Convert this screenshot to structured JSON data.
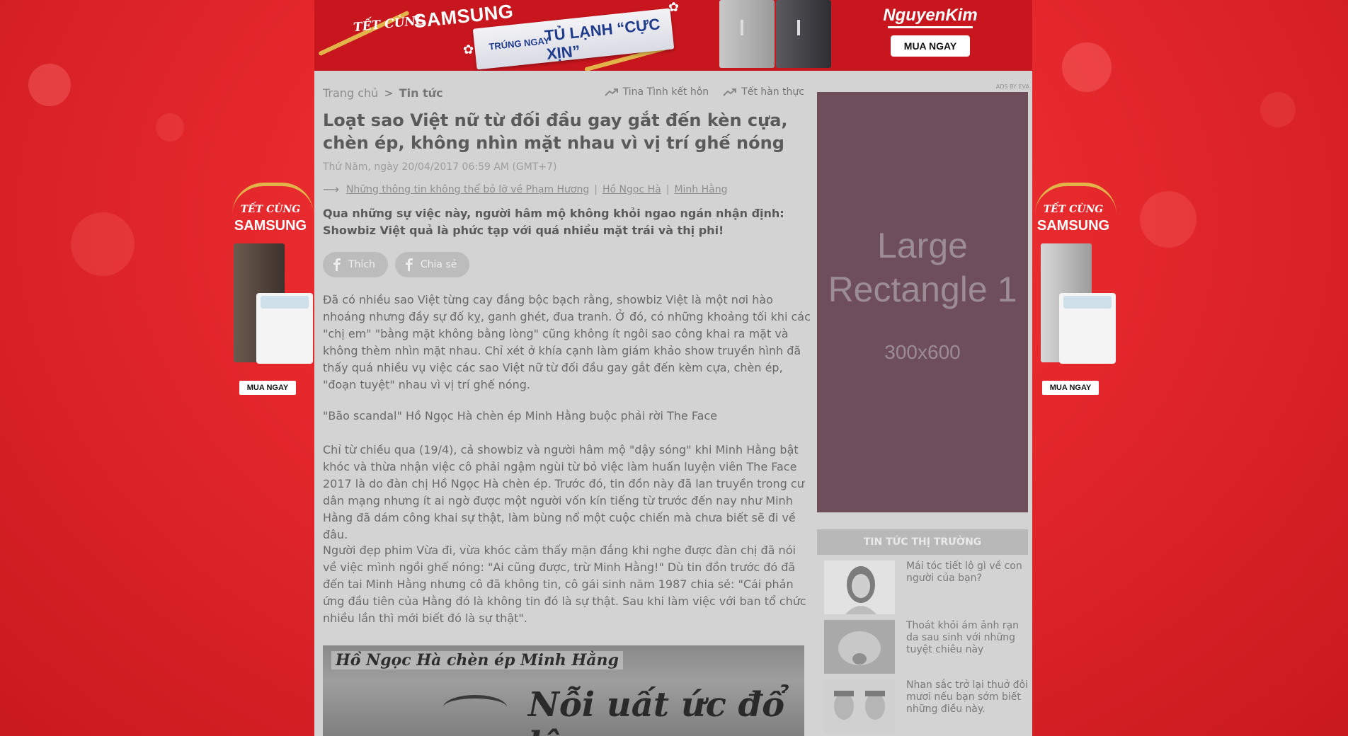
{
  "top_banner": {
    "tet": "TẾT CÙNG",
    "samsung": "SAMSUNG",
    "strip_small": "TRÚNG NGAY",
    "strip_big": "TỦ LẠNH “CỰC XỊN”",
    "brand": "NguyenKim",
    "cta": "MUA NGAY"
  },
  "side_left": {
    "tet": "TẾT CÙNG",
    "samsung": "SAMSUNG",
    "cta": "MUA NGAY"
  },
  "side_right": {
    "tet": "TẾT CÙNG",
    "samsung": "SAMSUNG",
    "cta": "MUA NGAY"
  },
  "breadcrumb": {
    "home": "Trang chủ",
    "sep": ">",
    "current": "Tin tức"
  },
  "tags": [
    {
      "label": "Tina Tình kết hôn",
      "icon": "trend-icon"
    },
    {
      "label": "Tết hàn thực",
      "icon": "trend-icon"
    }
  ],
  "article": {
    "title": "Loạt sao Việt nữ từ đối đầu gay gắt đến kèn cựa, chèn ép, không nhìn mặt nhau vì vị trí ghế nóng",
    "date": "Thứ Năm, ngày 20/04/2017 06:59 AM (GMT+7)",
    "related": [
      "Những thông tin không thể bỏ lỡ về Phạm Hương",
      "Hồ Ngọc Hà",
      "Minh Hằng"
    ],
    "related_sep": "|",
    "lead": "Qua những sự việc này, người hâm mộ không khỏi ngao ngán nhận định: Showbiz Việt quả là phức tạp với quá nhiều mặt trái và thị phi!",
    "like_label": "Thích",
    "share_label": "Chia sẻ",
    "paragraphs": [
      "Đã có nhiều sao Việt từng cay đắng bộc bạch rằng, showbiz Việt là một nơi hào nhoáng nhưng đầy sự đố kỵ, ganh ghét, đua tranh. Ở đó, có những khoảng tối khi các \"chị em\" \"bằng mặt không bằng lòng\" cũng không ít ngôi sao công khai ra mặt và không thèm nhìn mặt nhau. Chỉ xét ở khía cạnh làm giám khảo show truyền hình đã thấy quá nhiều vụ việc các sao Việt nữ từ đối đầu gay gắt đến kèm cựa, chèn ép, \"đoạn tuyệt\" nhau vì vị trí ghế nóng.",
      "\"Bão scandal\" Hồ Ngọc Hà chèn ép Minh Hằng buộc phải rời The Face",
      "Chỉ từ chiều qua (19/4), cả showbiz và người hâm mộ \"dậy sóng\" khi Minh Hằng bật khóc và thừa nhận việc cô phải ngậm ngùi từ bỏ việc làm huấn luyện viên The Face 2017 là do đàn chị Hồ Ngọc Hà chèn ép. Trước đó, tin đồn này đã lan truyền trong cư dân mạng nhưng ít ai ngờ được một người vốn kín tiếng từ trước đến nay như Minh Hằng đã dám công khai sự thật, làm bùng nổ một cuộc chiến mà chưa biết sẽ đi về đâu.",
      "Người đẹp phim Vừa đi, vừa khóc cảm thấy mặn đắng khi nghe được đàn chị đã nói về việc mình ngồi ghế nóng: \"Ai cũng được, trừ Minh Hằng!\" Dù tin đồn trước đó đã đến tai Minh Hằng nhưng cô đã không tin, cô gái sinh năm 1987 chia sẻ: \"Cái phản ứng đầu tiên của Hằng đó là không tin đó là sự thật. Sau khi làm việc với ban tổ chức nhiều lần thì mới biết đó là sự thật\"."
    ],
    "image_caption_1": "Hồ Ngọc Hà chèn ép Minh Hằng",
    "image_caption_2": "Nỗi uất ức đổ lệ"
  },
  "sidebar": {
    "ad_label": "ADS BY EVA",
    "ad_title": "Large Rectangle 1",
    "ad_size": "300x600",
    "market_heading": "TIN TỨC THỊ TRƯỜNG",
    "market_items": [
      "Mái tóc tiết lộ gì về con người của bạn?",
      "Thoát khỏi ám ảnh rạn da sau sinh với những tuyệt chiêu này",
      "Nhan sắc trở lại thuở đôi mươi nếu bạn sớm biết những điều này."
    ]
  },
  "colors": {
    "background_red": "#e5282c",
    "dim_overlay": "#d3d3d3",
    "ad_box": "#6e4e5a",
    "gold": "#e3b449"
  }
}
